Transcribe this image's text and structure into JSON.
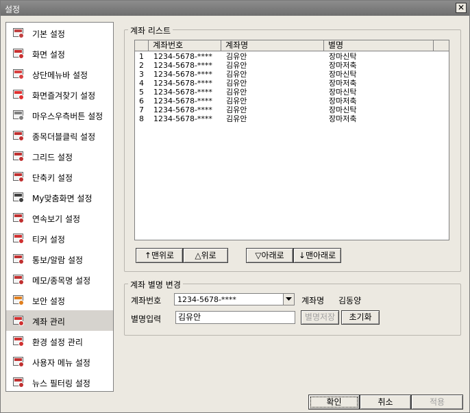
{
  "window": {
    "title": "설정",
    "close_glyph": "✕"
  },
  "sidebar": {
    "items": [
      {
        "label": "기본 설정",
        "icon": "monitor-gear-icon",
        "color": "#c04040"
      },
      {
        "label": "화면 설정",
        "icon": "monitor-red-icon",
        "color": "#c83030"
      },
      {
        "label": "상단메뉴바 설정",
        "icon": "menubar-icon",
        "color": "#d84040"
      },
      {
        "label": "화면즐겨찾기 설정",
        "icon": "star-icon",
        "color": "#e03030"
      },
      {
        "label": "마우스우측버튼 설정",
        "icon": "mouse-icon",
        "color": "#808080"
      },
      {
        "label": "종목더블클릭 설정",
        "icon": "cursor-icon",
        "color": "#c03030"
      },
      {
        "label": "그리드 설정",
        "icon": "grid-icon",
        "color": "#c03030"
      },
      {
        "label": "단축키 설정",
        "icon": "hotkey-icon",
        "color": "#c03030"
      },
      {
        "label": "My맞춤화면 설정",
        "icon": "custom-screen-icon",
        "color": "#404040"
      },
      {
        "label": "연속보기 설정",
        "icon": "magnifier-icon",
        "color": "#c03030"
      },
      {
        "label": "티커 설정",
        "icon": "ticker-icon",
        "color": "#d03030"
      },
      {
        "label": "통보/알람 설정",
        "icon": "alarm-icon",
        "color": "#c03030"
      },
      {
        "label": "메모/종목명 설정",
        "icon": "memo-icon",
        "color": "#c03030"
      },
      {
        "label": "보안 설정",
        "icon": "shield-icon",
        "color": "#e08020"
      },
      {
        "label": "계좌 관리",
        "icon": "account-icon",
        "color": "#d03030"
      },
      {
        "label": "환경 설정 관리",
        "icon": "gear-icon",
        "color": "#d03030"
      },
      {
        "label": "사용자 메뉴 설정",
        "icon": "user-menu-icon",
        "color": "#c03030"
      },
      {
        "label": "뉴스 필터링 설정",
        "icon": "news-icon",
        "color": "#c03030"
      }
    ],
    "selected_index": 14
  },
  "account_list": {
    "group_title": "계좌 리스트",
    "columns": [
      "계좌번호",
      "계좌명",
      "별명"
    ],
    "rows": [
      {
        "no": "1",
        "account": "1234-5678-****",
        "name": "김유안",
        "alias": "장마신탁"
      },
      {
        "no": "2",
        "account": "1234-5678-****",
        "name": "김유안",
        "alias": "장마저축"
      },
      {
        "no": "3",
        "account": "1234-5678-****",
        "name": "김유안",
        "alias": "장마신탁"
      },
      {
        "no": "4",
        "account": "1234-5678-****",
        "name": "김유안",
        "alias": "장마저축"
      },
      {
        "no": "5",
        "account": "1234-5678-****",
        "name": "김유안",
        "alias": "장마신탁"
      },
      {
        "no": "6",
        "account": "1234-5678-****",
        "name": "김유안",
        "alias": "장마저축"
      },
      {
        "no": "7",
        "account": "1234-5678-****",
        "name": "김유안",
        "alias": "장마신탁"
      },
      {
        "no": "8",
        "account": "1234-5678-****",
        "name": "김유안",
        "alias": "장마저축"
      }
    ],
    "buttons": {
      "top": "↑맨위로",
      "up": "△위로",
      "down": "▽아래로",
      "bottom": "↓맨아래로"
    }
  },
  "alias_change": {
    "group_title": "계좌 별명 변경",
    "account_label": "계좌번호",
    "account_value": "1234-5678-****",
    "name_label": "계좌명",
    "name_value": "김동양",
    "alias_label": "별명입력",
    "alias_value": "김유안",
    "save_label": "별명저장",
    "reset_label": "초기화"
  },
  "footer": {
    "ok": "확인",
    "cancel": "취소",
    "apply": "적용"
  }
}
